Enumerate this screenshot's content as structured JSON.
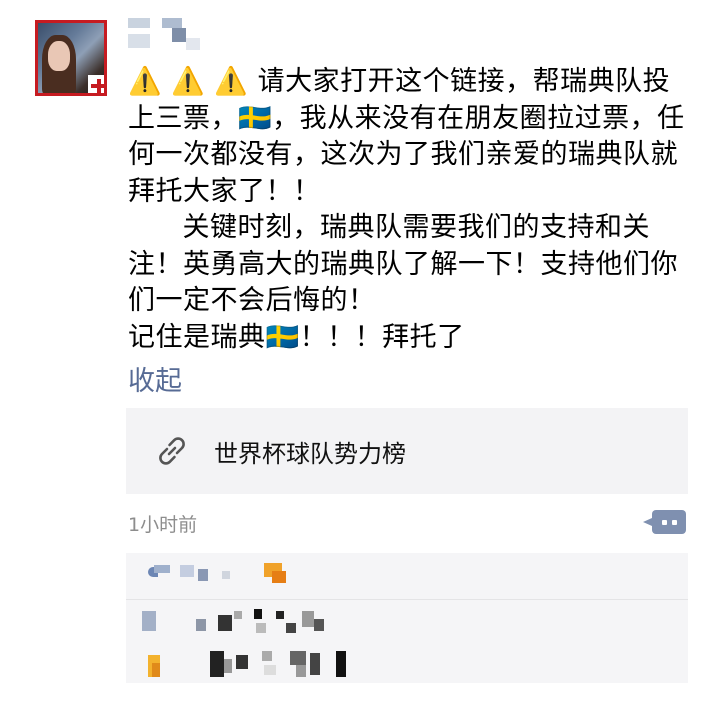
{
  "post": {
    "text": "⚠️ ⚠️ ⚠️ 请大家打开这个链接，帮瑞典队投上三票，🇸🇪，我从来没有在朋友圈拉过票，任何一次都没有，这次为了我们亲爱的瑞典队就拜托大家了！！\n      关键时刻，瑞典队需要我们的支持和关注！英勇高大的瑞典队了解一下！支持他们你们一定不会后悔的！\n记住是瑞典🇸🇪！！！拜托了",
    "collapse_label": "收起",
    "link_title": "世界杯球队势力榜",
    "timestamp": "1小时前"
  },
  "icons": {
    "link": "link-icon",
    "comment": "comment-icon",
    "like": "like-icon"
  },
  "colors": {
    "link_blue": "#576b95",
    "card_bg": "#f3f3f5",
    "likes_bg": "#f5f5f7",
    "avatar_border": "#c61b21"
  }
}
